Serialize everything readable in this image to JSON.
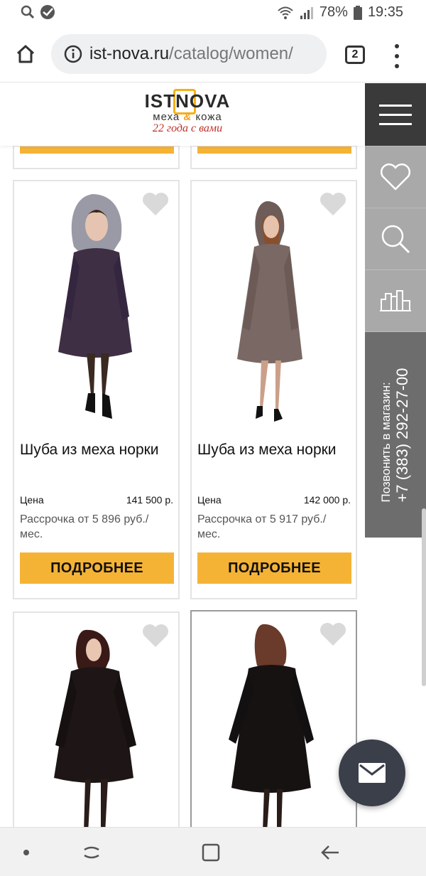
{
  "status_bar": {
    "battery": "78%",
    "time": "19:35",
    "icons": [
      "search-icon",
      "sber-icon",
      "wifi-icon",
      "signal-icon",
      "battery-icon"
    ]
  },
  "browser": {
    "url_host": "ist-nova.ru",
    "url_path": "/catalog/women/",
    "tab_count": "2",
    "icons": [
      "home-icon",
      "info-icon",
      "more-vert-icon"
    ]
  },
  "site": {
    "logo_brand_left": "IST",
    "logo_brand_n": "N",
    "logo_brand_right": "OVA",
    "logo_sub_left": "меха",
    "logo_sub_amp": "&",
    "logo_sub_right": "кожа",
    "logo_tagline": "22 года с вами",
    "accent_color": "#f5b335"
  },
  "rail": {
    "call_label": "Позвонить в магазин:",
    "phone": "+7 (383) 292-27-00",
    "icons": [
      "hamburger-icon",
      "heart-icon",
      "search-icon",
      "store-icon"
    ]
  },
  "products": [
    {
      "title": "Шуба из меха норки",
      "price_label": "Цена",
      "price": "141 500 р.",
      "installment": "Рассрочка от 5 896 руб./ мес.",
      "button": "ПОДРОБНЕЕ"
    },
    {
      "title": "Шуба из меха норки",
      "price_label": "Цена",
      "price": "142 000 р.",
      "installment": "Рассрочка от 5 917 руб./ мес.",
      "button": "ПОДРОБНЕЕ"
    }
  ],
  "fab": {
    "icon": "mail-icon"
  },
  "navbar": {
    "icons": [
      "dot-icon",
      "recents-icon",
      "home-square-icon",
      "back-icon"
    ]
  }
}
